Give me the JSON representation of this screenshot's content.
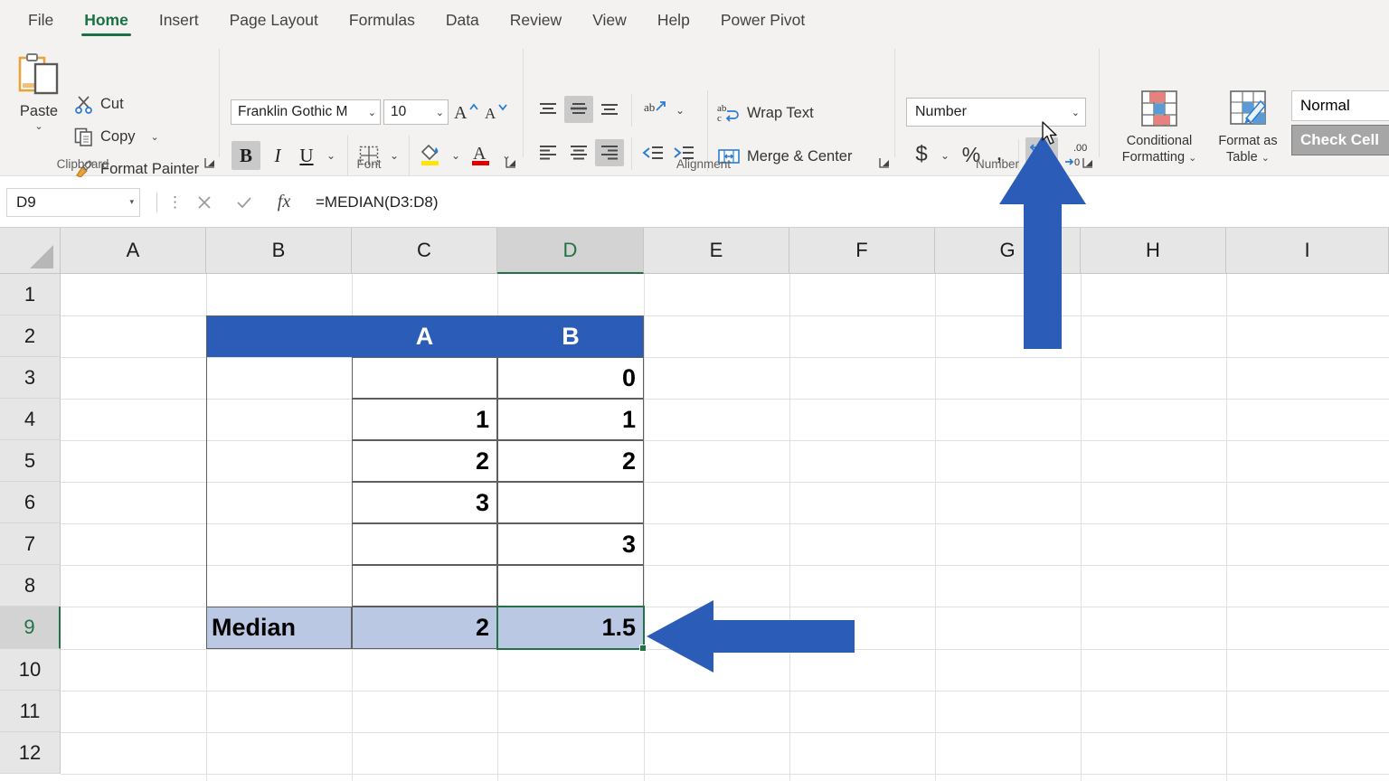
{
  "ribbon": {
    "tabs": [
      {
        "label": "File",
        "active": false
      },
      {
        "label": "Home",
        "active": true
      },
      {
        "label": "Insert",
        "active": false
      },
      {
        "label": "Page Layout",
        "active": false
      },
      {
        "label": "Formulas",
        "active": false
      },
      {
        "label": "Data",
        "active": false
      },
      {
        "label": "Review",
        "active": false
      },
      {
        "label": "View",
        "active": false
      },
      {
        "label": "Help",
        "active": false
      },
      {
        "label": "Power Pivot",
        "active": false
      }
    ],
    "groups": {
      "clipboard": {
        "label": "Clipboard",
        "paste": "Paste",
        "cut": "Cut",
        "copy": "Copy",
        "format_painter": "Format Painter"
      },
      "font": {
        "label": "Font",
        "font_name": "Franklin Gothic M",
        "font_size": "10",
        "bold": "B",
        "italic": "I",
        "underline": "U"
      },
      "alignment": {
        "label": "Alignment",
        "wrap_text": "Wrap Text",
        "merge_center": "Merge & Center"
      },
      "number": {
        "label": "Number",
        "format": "Number",
        "currency": "$",
        "percent": "%",
        "comma": ",",
        "increase_decimal": "Increase Decimal",
        "decrease_decimal": "Decrease Decimal"
      },
      "styles": {
        "conditional_formatting": "Conditional\nFormatting",
        "conditional_formatting_l1": "Conditional",
        "conditional_formatting_l2": "Formatting",
        "format_as_table_l1": "Format as",
        "format_as_table_l2": "Table",
        "style_normal": "Normal",
        "style_check_cell": "Check Cell"
      }
    }
  },
  "formula_bar": {
    "name_box": "D9",
    "formula": "=MEDIAN(D3:D8)",
    "cancel_icon": "close-icon",
    "enter_icon": "check-icon",
    "function_icon": "fx"
  },
  "grid": {
    "columns": [
      "A",
      "B",
      "C",
      "D",
      "E",
      "F",
      "G",
      "H",
      "I"
    ],
    "rows": [
      "1",
      "2",
      "3",
      "4",
      "5",
      "6",
      "7",
      "8",
      "9",
      "10",
      "11",
      "12"
    ],
    "selected_column": "D",
    "selected_row": "9",
    "selected_cell": "D9",
    "table": {
      "header_row": "2",
      "header_cells": {
        "B": "",
        "C": "A",
        "D": "B"
      },
      "data": [
        {
          "row": "3",
          "C": "",
          "D": "0"
        },
        {
          "row": "4",
          "C": "1",
          "D": "1"
        },
        {
          "row": "5",
          "C": "2",
          "D": "2"
        },
        {
          "row": "6",
          "C": "3",
          "D": ""
        },
        {
          "row": "7",
          "C": "",
          "D": "3"
        },
        {
          "row": "8",
          "C": "",
          "D": ""
        }
      ],
      "median_row": {
        "row": "9",
        "B": "Median",
        "C": "2",
        "D": "1.5"
      }
    }
  },
  "annotations": {
    "arrow_up_target": "increase-decimal-button",
    "arrow_left_target": "cell-D9",
    "color": "#2a5cb8"
  },
  "colors": {
    "ribbon_bg": "#f3f2f1",
    "accent_green": "#217346",
    "table_header_blue": "#2a5cb8",
    "median_fill": "#bac8e4",
    "arrow_blue": "#2a5cb8"
  }
}
